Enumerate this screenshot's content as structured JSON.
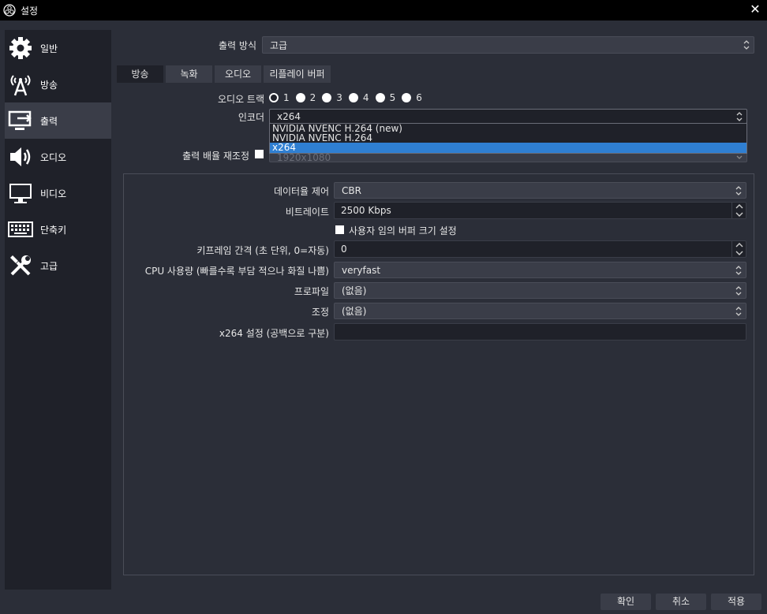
{
  "window": {
    "title": "설정",
    "close_glyph": "✕"
  },
  "sidebar": {
    "items": [
      {
        "label": "일반",
        "icon": "gear-icon"
      },
      {
        "label": "방송",
        "icon": "broadcast-antenna-icon"
      },
      {
        "label": "출력",
        "icon": "output-monitor-icon"
      },
      {
        "label": "오디오",
        "icon": "speaker-icon"
      },
      {
        "label": "비디오",
        "icon": "monitor-icon"
      },
      {
        "label": "단축키",
        "icon": "keyboard-icon"
      },
      {
        "label": "고급",
        "icon": "tools-icon"
      }
    ],
    "active_index": 2
  },
  "output_mode": {
    "label": "출력 방식",
    "value": "고급"
  },
  "tabs": [
    "방송",
    "녹화",
    "오디오",
    "리플레이 버퍼"
  ],
  "active_tab": 0,
  "audio_track": {
    "label": "오디오 트랙",
    "options": [
      "1",
      "2",
      "3",
      "4",
      "5",
      "6"
    ],
    "selected": "1"
  },
  "encoder": {
    "label": "인코더",
    "value": "x264",
    "dropdown_options": [
      "NVIDIA NVENC H.264 (new)",
      "NVIDIA NVENC H.264",
      "x264"
    ],
    "highlighted_option": "x264"
  },
  "rescale": {
    "label": "출력 배율 재조정",
    "value": "1920x1080"
  },
  "settings": {
    "rate_control": {
      "label": "데이터율 제어",
      "value": "CBR"
    },
    "bitrate": {
      "label": "비트레이트",
      "value": "2500 Kbps"
    },
    "custom_buffer": {
      "label": "사용자 임의 버퍼 크기 설정"
    },
    "keyframe": {
      "label": "키프레임 간격 (초 단위, 0=자동)",
      "value": "0"
    },
    "cpu_preset": {
      "label": "CPU 사용량 (빠를수록 부담 적으나 화질 나쁨)",
      "value": "veryfast"
    },
    "profile": {
      "label": "프로파일",
      "value": "(없음)"
    },
    "tune": {
      "label": "조정",
      "value": "(없음)"
    },
    "x264_opts": {
      "label": "x264 설정 (공백으로 구분)",
      "value": ""
    }
  },
  "buttons": {
    "ok": "확인",
    "cancel": "취소",
    "apply": "적용"
  },
  "colors": {
    "accent": "#2f7fd2",
    "background": "#2b2e38",
    "sidebar": "#1f2129"
  }
}
